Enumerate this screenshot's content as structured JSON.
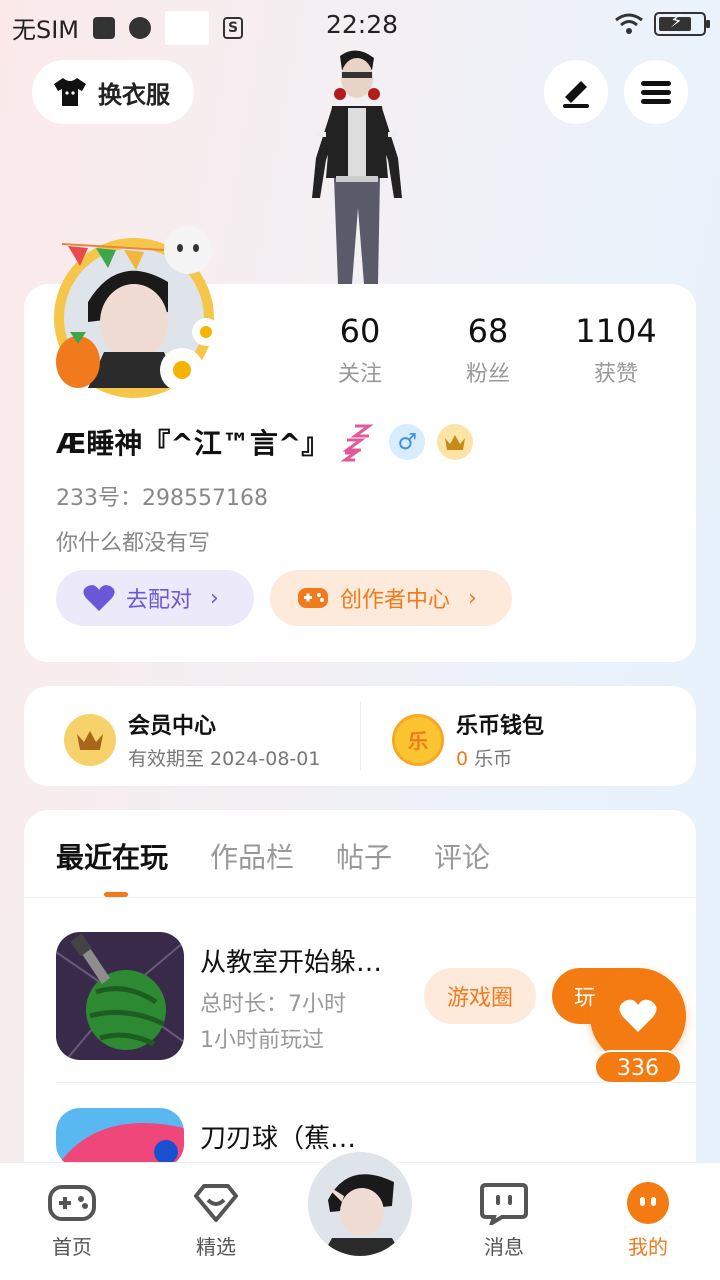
{
  "status_bar": {
    "carrier": "无SIM",
    "time": "22:28"
  },
  "header": {
    "outfit_label": "换衣服"
  },
  "profile": {
    "stats": [
      {
        "value": "60",
        "label": "关注"
      },
      {
        "value": "68",
        "label": "粉丝"
      },
      {
        "value": "1104",
        "label": "获赞"
      }
    ],
    "name": "Æ睡神『^江™言^』",
    "uid": "233号：298557168",
    "bio": "你什么都没有写",
    "match_label": "去配对",
    "creator_label": "创作者中心"
  },
  "member": {
    "vip_title": "会员中心",
    "vip_sub": "有效期至 2024-08-01",
    "wallet_title": "乐币钱包",
    "wallet_amount": "0",
    "wallet_unit": "乐币",
    "coin_glyph": "乐"
  },
  "tabs": [
    {
      "label": "最近在玩"
    },
    {
      "label": "作品栏"
    },
    {
      "label": "帖子"
    },
    {
      "label": "评论"
    }
  ],
  "games": [
    {
      "title": "从教室开始躲…",
      "duration": "总时长：7小时",
      "last_played": "1小时前玩过",
      "circle_label": "游戏圈",
      "play_label": "玩"
    },
    {
      "title": "刀刃球（蕉…"
    }
  ],
  "like_count": "336",
  "nav": {
    "home": "首页",
    "featured": "精选",
    "messages": "消息",
    "mine": "我的"
  },
  "colors": {
    "accent": "#f47a12",
    "match_purple": "#6a58d8",
    "male_blue": "#3a93e0"
  }
}
